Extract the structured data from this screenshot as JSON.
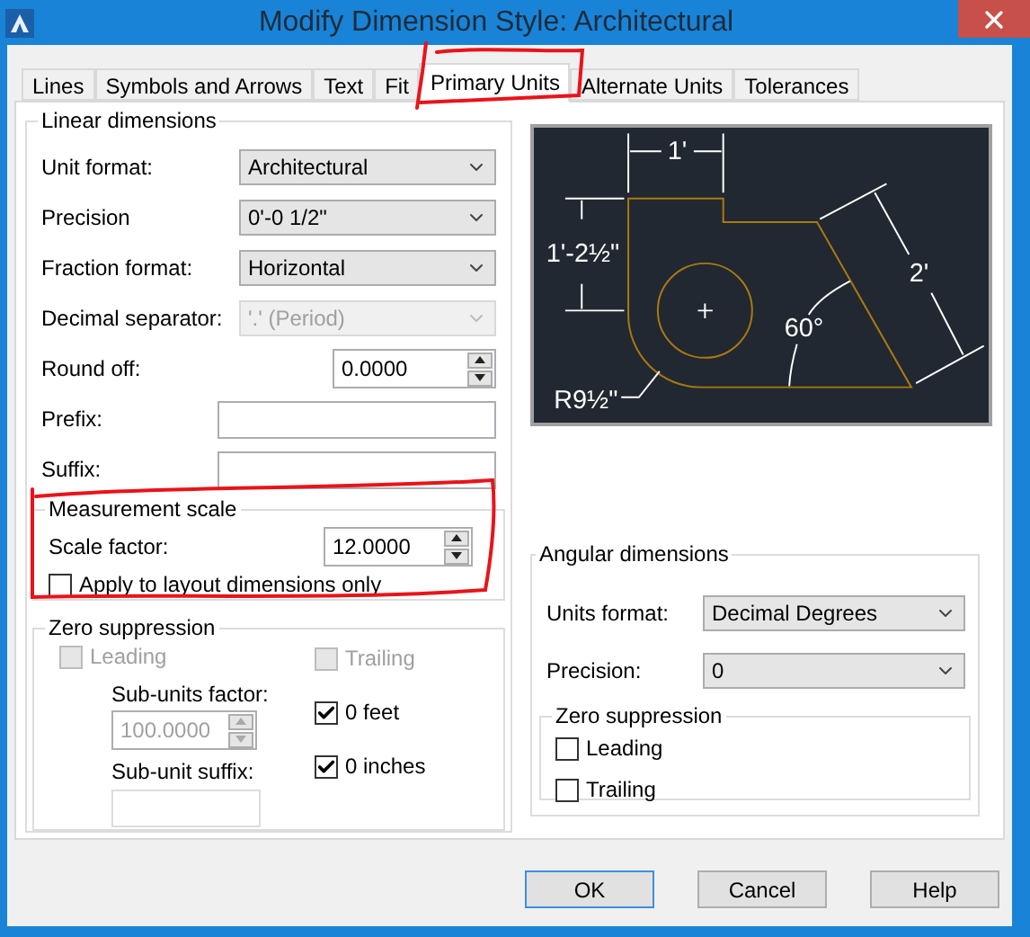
{
  "window": {
    "title": "Modify Dimension Style: Architectural"
  },
  "tabs": [
    {
      "label": "Lines",
      "selected": false
    },
    {
      "label": "Symbols and Arrows",
      "selected": false
    },
    {
      "label": "Text",
      "selected": false
    },
    {
      "label": "Fit",
      "selected": false
    },
    {
      "label": "Primary Units",
      "selected": true
    },
    {
      "label": "Alternate Units",
      "selected": false
    },
    {
      "label": "Tolerances",
      "selected": false
    }
  ],
  "linear_dimensions": {
    "title": "Linear dimensions",
    "fields": [
      {
        "kind": "select",
        "label": "Unit format:",
        "value": "Architectural",
        "disabled": false
      },
      {
        "kind": "select",
        "label": "Precision",
        "value": "0'-0 1/2\"",
        "disabled": false
      },
      {
        "kind": "select",
        "label": "Fraction format:",
        "value": "Horizontal",
        "disabled": false
      },
      {
        "kind": "select",
        "label": "Decimal separator:",
        "value": "'.' (Period)",
        "disabled": true
      },
      {
        "kind": "spinner",
        "label": "Round off:",
        "value": "0.0000",
        "disabled": false
      },
      {
        "kind": "text",
        "label": "Prefix:",
        "disabled": false
      },
      {
        "kind": "text",
        "label": "Suffix:",
        "disabled": false
      }
    ]
  },
  "measurement_scale": {
    "title": "Measurement scale",
    "scale_label": "Scale factor:",
    "scale_value": "12.0000",
    "apply": {
      "label": "Apply to layout dimensions only",
      "checked": false,
      "disabled": false
    }
  },
  "zero_suppression": {
    "title": "Zero suppression",
    "leading": {
      "label": "Leading",
      "checked": false,
      "disabled": true
    },
    "trailing": {
      "label": "Trailing",
      "checked": false,
      "disabled": true
    },
    "sub_units_factor_label": "Sub-units factor:",
    "sub_units_factor": {
      "value": "100.0000",
      "disabled": true
    },
    "sub_unit_suffix_label": "Sub-unit suffix:",
    "feet": {
      "label": "0 feet",
      "checked": true,
      "disabled": false
    },
    "inches": {
      "label": "0 inches",
      "checked": true,
      "disabled": false
    }
  },
  "preview": {
    "labels": [
      "1'",
      "1'-2½\"",
      "2'",
      "60°",
      "R9½\""
    ]
  },
  "angular_dimensions": {
    "title": "Angular dimensions",
    "fields": [
      {
        "kind": "select",
        "label": "Units format:",
        "value": "Decimal Degrees",
        "disabled": false
      },
      {
        "kind": "select",
        "label": "Precision:",
        "value": "0",
        "disabled": false
      }
    ],
    "zero_suppression": {
      "title": "Zero suppression",
      "options": [
        {
          "label": "Leading",
          "checked": false,
          "disabled": false
        },
        {
          "label": "Trailing",
          "checked": false,
          "disabled": false
        }
      ]
    }
  },
  "buttons": [
    {
      "label": "OK",
      "default": true
    },
    {
      "label": "Cancel",
      "default": false
    },
    {
      "label": "Help",
      "default": false
    }
  ]
}
